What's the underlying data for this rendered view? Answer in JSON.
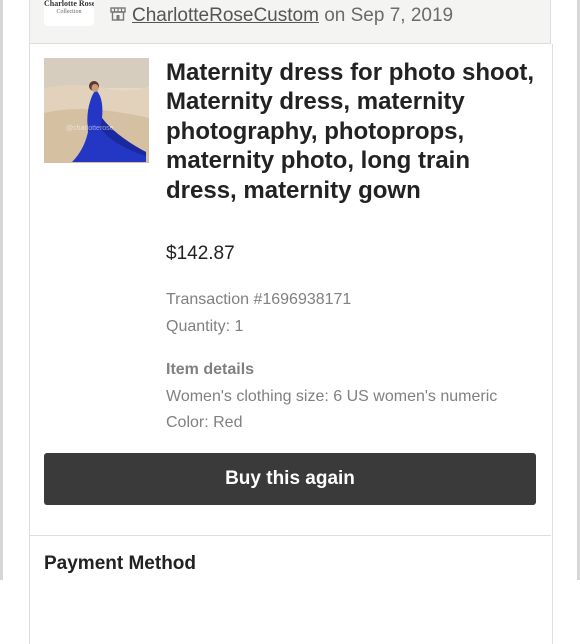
{
  "shop": {
    "logo_line1": "Charlotte Rose",
    "logo_line2": "Collection",
    "icon": "shop-icon",
    "name": "CharlotteRoseCustom",
    "date_text": "on Sep 7, 2019"
  },
  "item": {
    "image_icon": "product-photo",
    "watermark": "@charlotterose",
    "title": "Maternity dress for photo shoot, Maternity dress, maternity photography, photoprops, maternity photo, long train dress, maternity gown",
    "price": "$142.87",
    "transaction": "Transaction #1696938171",
    "quantity": "Quantity: 1",
    "details_heading": "Item details",
    "size": "Women's clothing size: 6 US women's numeric",
    "color": "Color: Red"
  },
  "actions": {
    "buy_again": "Buy this again"
  },
  "payment": {
    "heading": "Payment Method"
  },
  "colors": {
    "button_bg": "#3a3a3a",
    "text_primary": "#222222",
    "text_muted": "#808080",
    "dress_blue": "#2436c4"
  }
}
